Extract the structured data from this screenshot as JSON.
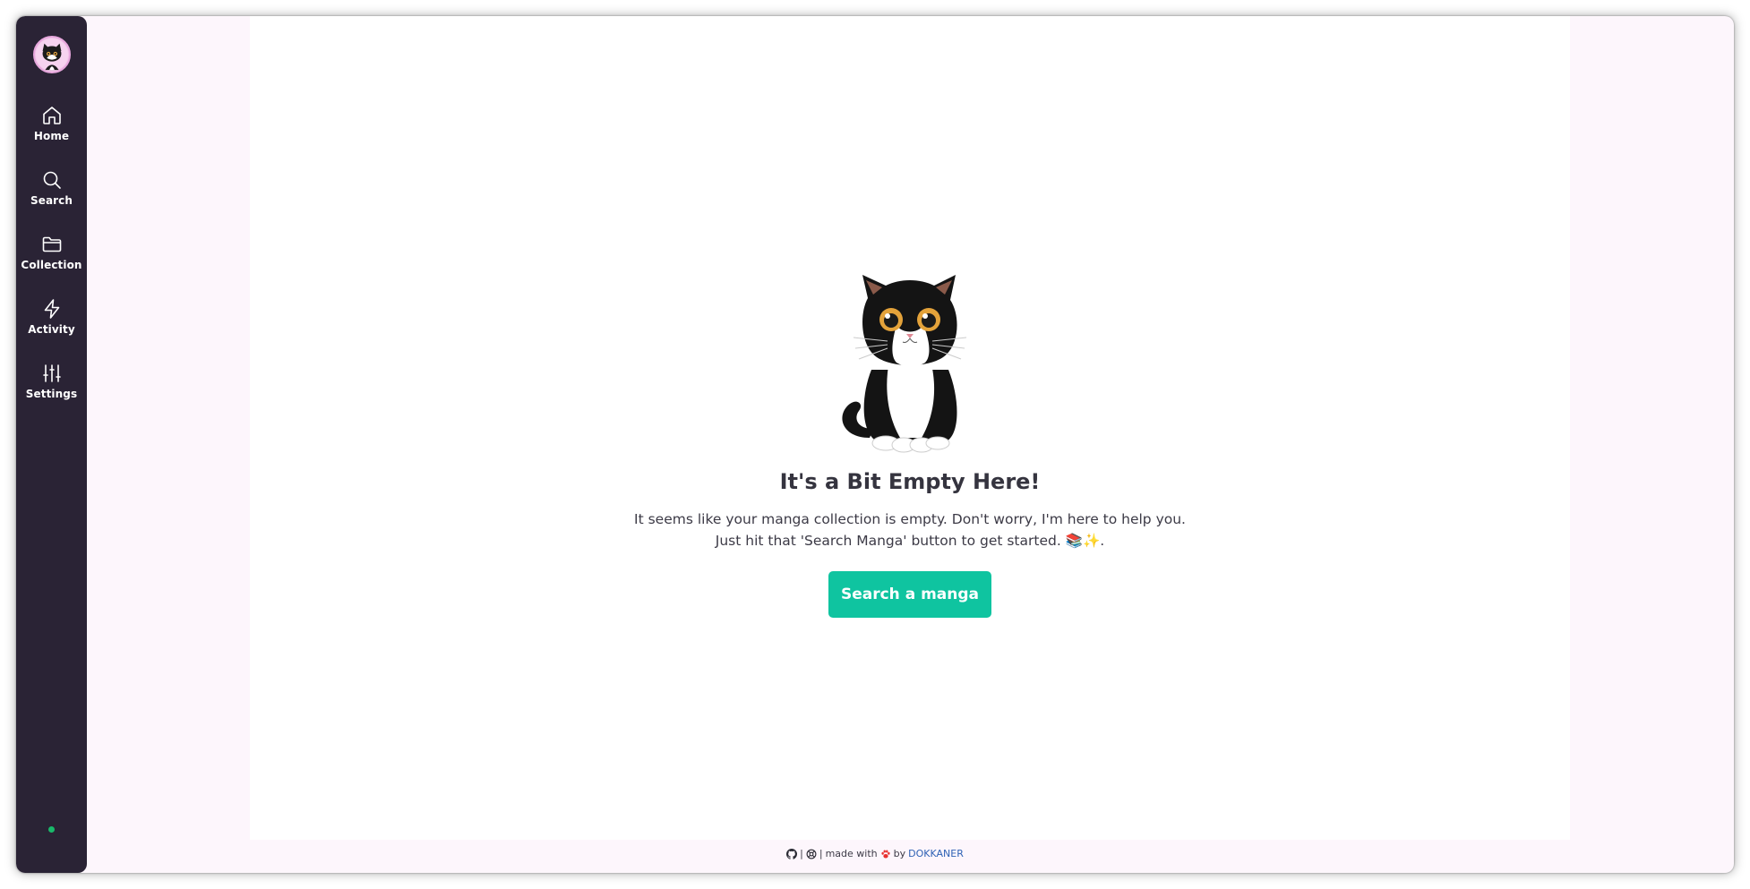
{
  "sidebar": {
    "items": [
      {
        "label": "Home",
        "icon": "home-icon"
      },
      {
        "label": "Search",
        "icon": "search-icon"
      },
      {
        "label": "Collection",
        "icon": "folder-icon"
      },
      {
        "label": "Activity",
        "icon": "lightning-icon"
      },
      {
        "label": "Settings",
        "icon": "sliders-icon"
      }
    ],
    "status_color": "#19b86a"
  },
  "empty_state": {
    "title": "It's a Bit Empty Here!",
    "line1": "It seems like your manga collection is empty. Don't worry, I'm here to help you.",
    "line2": "Just hit that 'Search Manga' button to get started. 📚✨.",
    "button": "Search a manga"
  },
  "footer": {
    "separator": "|",
    "made_with": "made with",
    "by": "by",
    "author": "DOKKANER"
  },
  "colors": {
    "sidebar": "#2a2335",
    "accent": "#0fc4a0",
    "link": "#2f62b5"
  }
}
